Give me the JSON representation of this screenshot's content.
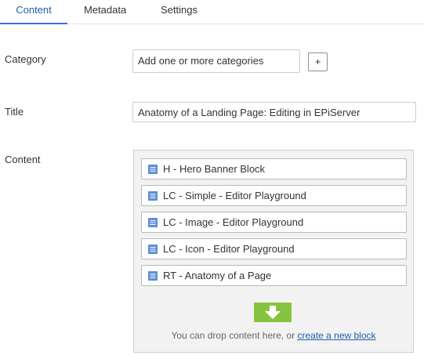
{
  "tabs": [
    {
      "label": "Content",
      "active": true
    },
    {
      "label": "Metadata",
      "active": false
    },
    {
      "label": "Settings",
      "active": false
    }
  ],
  "fields": {
    "category": {
      "label": "Category",
      "placeholder": "Add one or more categories",
      "add_button": "+"
    },
    "title": {
      "label": "Title",
      "value": "Anatomy of a Landing Page: Editing in EPiServer"
    },
    "content": {
      "label": "Content",
      "blocks": [
        {
          "label": "H - Hero Banner Block",
          "icon": "block-icon"
        },
        {
          "label": "LC - Simple - Editor Playground",
          "icon": "block-icon"
        },
        {
          "label": "LC - Image - Editor Playground",
          "icon": "block-icon"
        },
        {
          "label": "LC - Icon - Editor Playground",
          "icon": "block-icon"
        },
        {
          "label": "RT - Anatomy of a Page",
          "icon": "block-icon"
        }
      ],
      "drop_icon": "download-arrow-icon",
      "drop_text": "You can drop content here, or ",
      "create_link": "create a new block"
    }
  },
  "colors": {
    "accent": "#3b70d8",
    "link": "#1f5fa8",
    "drop_green": "#86c440",
    "block_icon": "#5b8ed6"
  }
}
